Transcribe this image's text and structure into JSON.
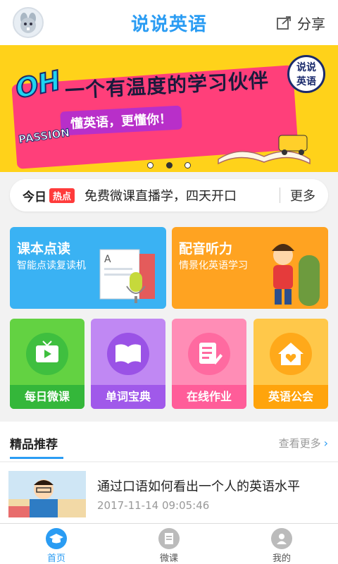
{
  "header": {
    "title": "说说英语",
    "share_label": "分享",
    "icons": {
      "avatar": "squirrel-avatar",
      "share": "share-icon"
    }
  },
  "banner": {
    "oh_text": "OH",
    "slogan": "一个有温度的学习伙伴",
    "subtitle": "懂英语，更懂你！",
    "badge_line1": "说说",
    "badge_line2": "英语",
    "passion_text": "PASSION",
    "slide_count": 3,
    "active_slide": 2,
    "colors": {
      "background": "#ffd21a",
      "stripe": "#ff3f7a"
    }
  },
  "notice": {
    "today": "今日",
    "hot_badge": "热点",
    "text": "免费微课直播学，四天开口",
    "more": "更多"
  },
  "features": [
    {
      "title": "课本点读",
      "subtitle": "智能点读复读机",
      "color": "#3ab2f3",
      "icon": "book-microphone-illustration"
    },
    {
      "title": "配音听力",
      "subtitle": "情景化英语学习",
      "color": "#ffa321",
      "icon": "character-illustration"
    }
  ],
  "tiles": [
    {
      "label": "每日微课",
      "icon": "tv-icon"
    },
    {
      "label": "单词宝典",
      "icon": "open-book-icon"
    },
    {
      "label": "在线作业",
      "icon": "homework-edit-icon"
    },
    {
      "label": "英语公会",
      "icon": "heart-house-icon"
    }
  ],
  "recommend": {
    "title": "精品推荐",
    "more": "查看更多"
  },
  "article": {
    "title": "通过口语如何看出一个人的英语水平",
    "time": "2017-11-14 09:05:46"
  },
  "tabbar": {
    "active": 0,
    "tabs": [
      {
        "label": "首页",
        "icon": "graduation-cap-icon"
      },
      {
        "label": "微课",
        "icon": "document-icon"
      },
      {
        "label": "我的",
        "icon": "user-icon"
      }
    ]
  },
  "colors": {
    "accent": "#2a9cf3",
    "hot": "#ff3b3b"
  }
}
